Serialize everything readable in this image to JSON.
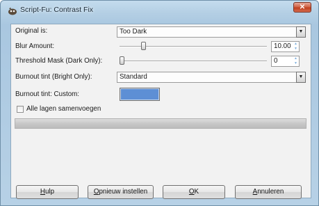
{
  "window": {
    "title": "Script-Fu: Contrast Fix",
    "close_glyph": "✕"
  },
  "form": {
    "original": {
      "label": "Original is:",
      "value": "Too Dark"
    },
    "blur": {
      "label": "Blur Amount:",
      "value": "10.00",
      "slider_fraction": 0.15
    },
    "threshold": {
      "label": "Threshold Mask (Dark Only):",
      "value": "0",
      "slider_fraction": 0.0
    },
    "burnout_tint": {
      "label": "Burnout tint (Bright Only):",
      "value": "Standard"
    },
    "burnout_custom": {
      "label": "Burnout tint: Custom:",
      "color": "#5d8fd5"
    },
    "flatten": {
      "label": "Alle lagen samenvoegen",
      "checked": false
    }
  },
  "buttons": {
    "help": {
      "accel": "H",
      "rest": "ulp"
    },
    "reset": {
      "accel": "O",
      "rest": "pnieuw instellen"
    },
    "ok": {
      "accel": "O",
      "rest": "K"
    },
    "cancel": {
      "accel": "A",
      "rest": "nnuleren"
    }
  },
  "icons": {
    "app": "gimp-icon",
    "dropdown": "chevron-down-icon",
    "spin": "spin-arrows-icon"
  }
}
